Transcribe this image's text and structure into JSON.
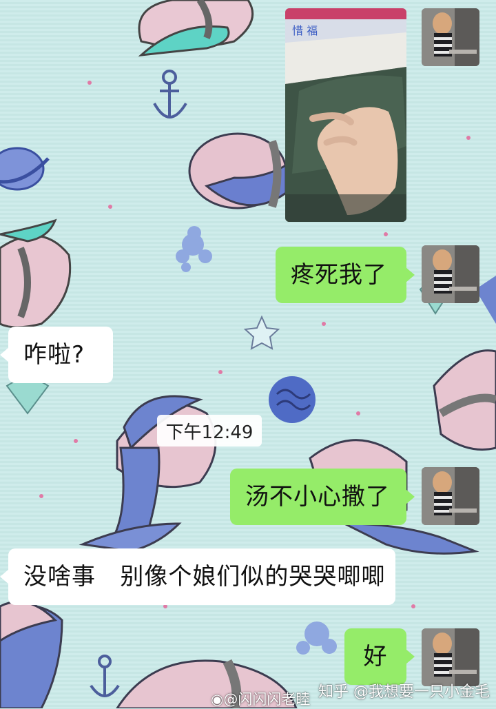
{
  "chat": {
    "messages": [
      {
        "sender": "self",
        "type": "image",
        "content": "photo of a hand on green trousers"
      },
      {
        "sender": "self",
        "type": "text",
        "text": "疼死我了"
      },
      {
        "sender": "other",
        "type": "text",
        "text": "咋啦?"
      },
      {
        "sender": "self",
        "type": "text",
        "text": "汤不小心撒了"
      },
      {
        "sender": "other",
        "type": "text",
        "text": "没啥事   别像个娘们似的哭哭唧唧"
      },
      {
        "sender": "self",
        "type": "text",
        "text": "好"
      }
    ],
    "timestamp": "下午12:49",
    "photo_sign_text": "惜 福"
  },
  "watermarks": {
    "weibo": "@闪闪闪老睦",
    "zhihu": "知乎 @我想要一只小金毛"
  },
  "colors": {
    "background": "#c9e8e6",
    "bubble_self": "#95ec69",
    "bubble_other": "#ffffff"
  },
  "icons": [
    "whale-icon",
    "anchor-icon",
    "planet-icon",
    "starfish-icon",
    "coral-icon",
    "shell-icon"
  ]
}
